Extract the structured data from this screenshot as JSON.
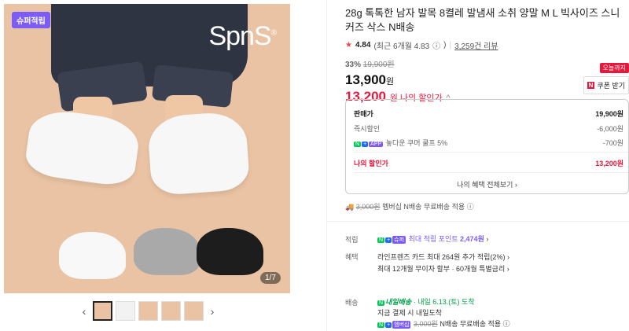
{
  "gallery": {
    "badge": "슈퍼적립",
    "brand": "SpnS",
    "brand_mark": "®",
    "counter": "1/7",
    "prev_arrow": "‹",
    "next_arrow": "›"
  },
  "product": {
    "title": "28g 톡톡한 남자 발목 8켤레 발냄새 소취 양말 M L 빅사이즈 스니커즈 삭스 N배송",
    "rating": "4.84",
    "rating_recent": "(최근 6개월 4.83",
    "info_icon": "ⓘ",
    "rating_close": ")",
    "review_count": "3,259건 리뷰",
    "discount_pct": "33%",
    "original_price": "19,900원",
    "price": "13,900",
    "won": "원",
    "my_price": "13,200",
    "my_price_label": "원 나의 할인가",
    "chevron": "^"
  },
  "coupon": {
    "today": "오늘까지",
    "n": "N",
    "label": "쿠폰 받기"
  },
  "breakdown": {
    "sale_label": "판매가",
    "sale_value": "19,900원",
    "instant_label": "즉시할인",
    "instant_value": "-6,000원",
    "n_pill": "N",
    "plus_pill": "+",
    "app_pill": "APP",
    "coupon_label": "놓다운 쿠머 쿨프 5%",
    "coupon_value": "-700원",
    "my_label": "나의 할인가",
    "my_value": "13,200원",
    "more": "나의 혜택 전체보기 ›"
  },
  "shipping": {
    "orig": "3,000원",
    "text": "멤버십 N배송 무료배송 적용",
    "info_icon": "ⓘ"
  },
  "points": {
    "label": "적립",
    "super_pill": "슈퍼",
    "text": "최대 적립 포인트",
    "amount": "2,474원",
    "arrow": "›"
  },
  "benefit": {
    "label": "혜택",
    "line1": "라인프렌즈 카드 최대 264원 추가 적립(2%) ›",
    "line2": "최대 12개월 무이자 할부 · 60개월 특별금리 ›"
  },
  "delivery": {
    "label": "배송",
    "n_logo": "N",
    "service": "내일배송",
    "date": "· 내일 6.13.(토) 도착",
    "line2": "지금 결제 시 내일도착",
    "member_pill": "멤버십",
    "orig": "3,000원",
    "line3": "N배송 무료배송 적용",
    "info_icon": "ⓘ"
  }
}
